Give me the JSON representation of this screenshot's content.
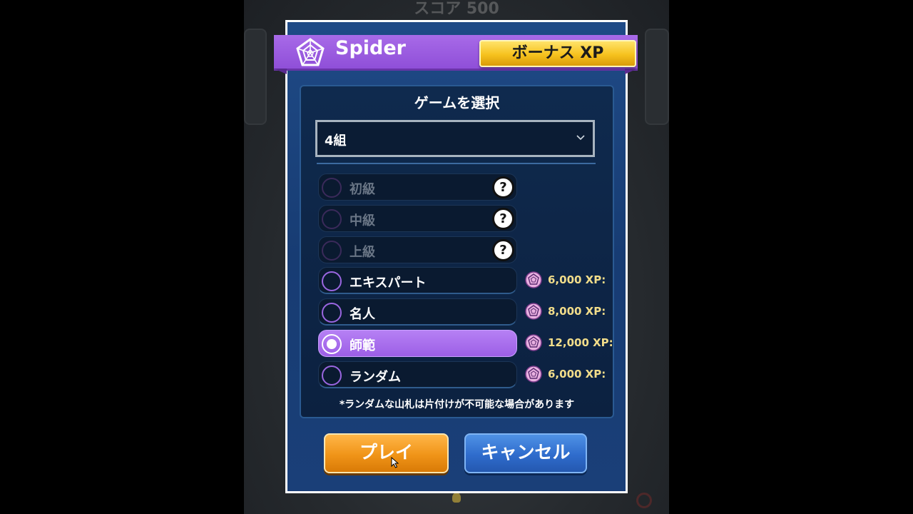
{
  "background": {
    "score_text": "スコア 500"
  },
  "dialog": {
    "title": "Spider",
    "title_icon": "spider-web-icon",
    "bonus_badge": "ボーナス XP",
    "heading": "ゲームを選択",
    "select": {
      "value": "4組",
      "chevron_icon": "chevron-down-icon"
    },
    "options": [
      {
        "label": "初級",
        "state": "disabled",
        "selected": false,
        "help": "?"
      },
      {
        "label": "中級",
        "state": "disabled",
        "selected": false,
        "help": "?"
      },
      {
        "label": "上級",
        "state": "disabled",
        "selected": false,
        "help": "?"
      },
      {
        "label": "エキスパート",
        "state": "enabled",
        "selected": false,
        "xp": "6,000 XP:"
      },
      {
        "label": "名人",
        "state": "enabled",
        "selected": false,
        "xp": "8,000 XP:"
      },
      {
        "label": "師範",
        "state": "enabled",
        "selected": true,
        "xp": "12,000 XP:"
      },
      {
        "label": "ランダム",
        "state": "enabled",
        "selected": false,
        "xp": "6,000 XP:"
      }
    ],
    "footnote": "*ランダムな山札は片付けが不可能な場合があります",
    "buttons": {
      "play": "プレイ",
      "cancel": "キャンセル"
    }
  },
  "colors": {
    "banner_purple": "#9b5de5",
    "bonus_gold": "#f6c21e",
    "dialog_blue": "#1a4078",
    "selected_purple": "#a86aee",
    "play_orange": "#f09418",
    "cancel_blue": "#2f6ccc",
    "xp_text": "#f2dd8a"
  }
}
